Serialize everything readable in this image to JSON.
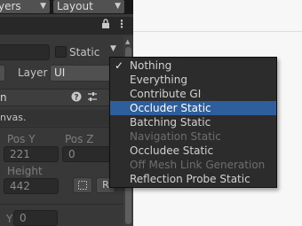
{
  "toolbar": {
    "layers_label": "yers",
    "layout_label": "Layout"
  },
  "header": {
    "lock_icon": "lock-icon",
    "more_icon": "kebab-icon"
  },
  "object": {
    "static_label": "Static",
    "layer_label": "Layer",
    "layer_value": "UI"
  },
  "component": {
    "name_fragment": "n",
    "help_icon": "help-icon",
    "settings_icon": "sliders-icon"
  },
  "notice": {
    "text": "nvas."
  },
  "transform": {
    "pos_y_label": "Pos Y",
    "pos_z_label": "Pos Z",
    "pos_y_value": "221",
    "pos_z_value": "0",
    "height_label": "Height",
    "height_value": "442",
    "r_button": "R",
    "y_label": "Y",
    "y_value": "0"
  },
  "static_menu": {
    "items": [
      {
        "label": "Nothing",
        "checked": true,
        "highlighted": false,
        "disabled": false
      },
      {
        "label": "Everything",
        "checked": false,
        "highlighted": false,
        "disabled": false
      },
      {
        "label": "Contribute GI",
        "checked": false,
        "highlighted": false,
        "disabled": false
      },
      {
        "label": "Occluder Static",
        "checked": false,
        "highlighted": true,
        "disabled": false
      },
      {
        "label": "Batching Static",
        "checked": false,
        "highlighted": false,
        "disabled": false
      },
      {
        "label": "Navigation Static",
        "checked": false,
        "highlighted": false,
        "disabled": true
      },
      {
        "label": "Occludee Static",
        "checked": false,
        "highlighted": false,
        "disabled": false
      },
      {
        "label": "Off Mesh Link Generation",
        "checked": false,
        "highlighted": false,
        "disabled": true
      },
      {
        "label": "Reflection Probe Static",
        "checked": false,
        "highlighted": false,
        "disabled": false
      }
    ]
  },
  "colors": {
    "highlight": "#2e5f9c",
    "panel": "#383838",
    "menu_bg": "#2c2c2c"
  }
}
